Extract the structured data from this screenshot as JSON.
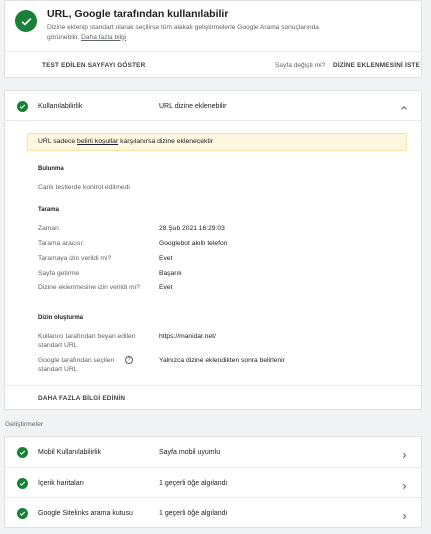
{
  "status": {
    "title": "URL, Google tarafından kullanılabilir",
    "description": "Dizine eklenip standart olarak seçilirse tüm alakalı geliştirmelerle Google Arama sonuçlarında görünebilir.",
    "learn_more": "Daha fazla bilgi",
    "test_button": "TEST EDİLEN SAYFAYI GÖSTER",
    "page_changed": "Sayfa değişti mi?",
    "request_index_button": "DİZİNE EKLENMESİNİ İSTE",
    "accent_color": "#188038"
  },
  "coverage": {
    "header_label": "Kullanılabilirlik",
    "header_value": "URL dizine eklenebilir",
    "notice_prefix": "URL sadece",
    "notice_link": "belirli koşullar",
    "notice_suffix": "karşılanırsa dizine eklenecektir",
    "discovery": {
      "title": "Bulunma",
      "text": "Canlı testlerde kontrol edilmedi"
    },
    "crawl": {
      "title": "Tarama",
      "rows": [
        {
          "label": "Zaman",
          "value": "28 Şub 2021 16:29:03"
        },
        {
          "label": "Tarama aracısı:",
          "value": "Googlebot akıllı telefon"
        },
        {
          "label": "Taramaya izin verildi mi?",
          "value": "Evet"
        },
        {
          "label": "Sayfa getirme",
          "value": "Başarılı"
        },
        {
          "label": "Dizine eklenmesine izin verildi mi?",
          "value": "Evet"
        }
      ]
    },
    "indexing": {
      "title": "Dizin oluşturma",
      "user_canonical_label": "Kullanıcı tarafından beyan edilen standart URL",
      "user_canonical_value": "https://manidar.net/",
      "google_canonical_label": "Google tarafından seçilen standart URL",
      "google_canonical_value": "Yalnızca dizine eklendikten sonra belirlenir",
      "help_glyph": "?"
    },
    "more_info_button": "DAHA FAZLA BİLGİ EDİNİN"
  },
  "enhancements": {
    "title": "Geliştirmeler",
    "rows": [
      {
        "label": "Mobil Kullanılabilirlik",
        "value": "Sayfa mobil uyumlu"
      },
      {
        "label": "İçerik haritaları",
        "value": "1 geçerli öğe algılandı"
      },
      {
        "label": "Google Sitelinks arama kutusu",
        "value": "1 geçerli öğe algılandı"
      }
    ]
  }
}
